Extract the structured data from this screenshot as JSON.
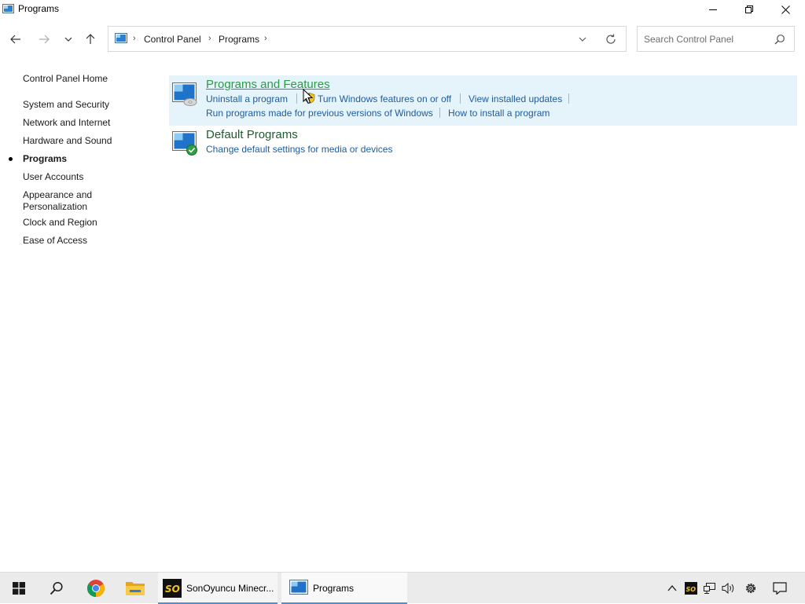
{
  "window": {
    "title": "Programs"
  },
  "breadcrumbs": [
    "Control Panel",
    "Programs"
  ],
  "search": {
    "placeholder": "Search Control Panel",
    "value": ""
  },
  "leftnav": {
    "home": "Control Panel Home",
    "items": [
      {
        "label": "System and Security",
        "current": false
      },
      {
        "label": "Network and Internet",
        "current": false
      },
      {
        "label": "Hardware and Sound",
        "current": false
      },
      {
        "label": "Programs",
        "current": true
      },
      {
        "label": "User Accounts",
        "current": false
      },
      {
        "label": "Appearance and",
        "label2": "Personalization",
        "current": false
      },
      {
        "label": "Clock and Region",
        "current": false
      },
      {
        "label": "Ease of Access",
        "current": false
      }
    ]
  },
  "sections": {
    "programs_features": {
      "title": "Programs and Features",
      "tasks": [
        "Uninstall a program",
        "Turn Windows features on or off",
        "View installed updates",
        "Run programs made for previous versions of Windows",
        "How to install a program"
      ]
    },
    "default_programs": {
      "title": "Default Programs",
      "tasks": [
        "Change default settings for media or devices"
      ]
    }
  },
  "taskbar": {
    "apps": [
      {
        "label": "SonOyuncu Minecr...",
        "icon": "sonoyuncu-icon"
      },
      {
        "label": "Programs",
        "icon": "control-panel-icon"
      }
    ],
    "pinned": [
      "start-icon",
      "search-icon",
      "chrome-icon",
      "file-explorer-icon"
    ],
    "tray": [
      "chevron-up-icon",
      "sonoyuncu-tray-icon",
      "network-icon",
      "volume-icon",
      "settings-icon",
      "notification-icon"
    ]
  },
  "colors": {
    "accent": "#4a90d9",
    "link": "#1e5c9c",
    "section_title": "#1e5c2d",
    "section_hover": "#2d9b46",
    "highlight_bg": "#e5f3fb"
  }
}
